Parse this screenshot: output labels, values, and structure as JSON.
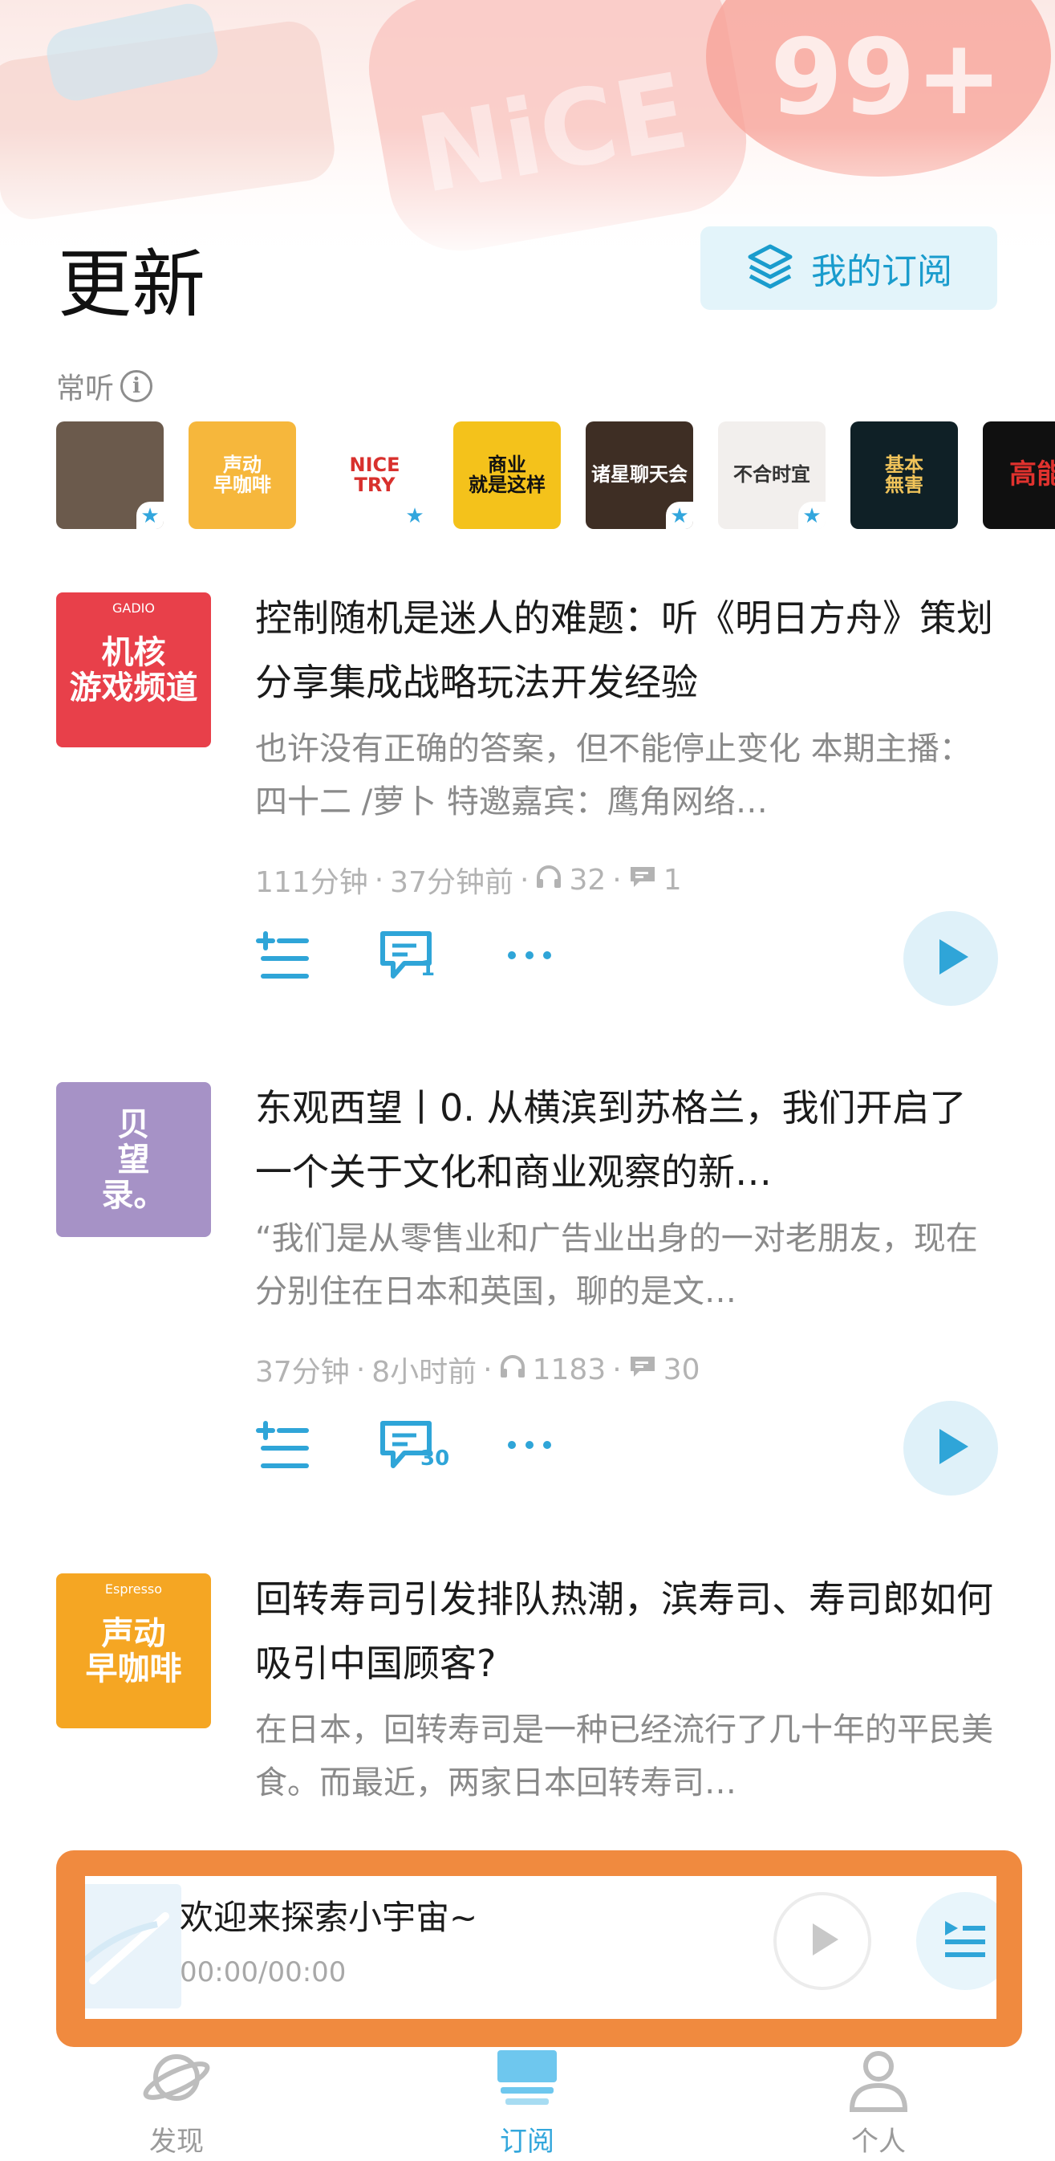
{
  "header": {
    "title": "更新",
    "my_subscriptions_label": "我的订阅"
  },
  "hero": {
    "badge_text": "99+",
    "art_text": "NiCE"
  },
  "frequent": {
    "label": "常听",
    "items": [
      {
        "name": "avatar-person",
        "caption": "",
        "bg": "#6b5a4c",
        "fg": "#ffffff",
        "starred": true
      },
      {
        "name": "声动早咖啡",
        "caption": "声动\n早咖啡",
        "bg": "#f6b73c",
        "fg": "#ffffff",
        "starred": false
      },
      {
        "name": "Nice Try",
        "caption": "NICE\nTRY",
        "bg": "#ffffff",
        "fg": "#d8302d",
        "starred": true
      },
      {
        "name": "商业就是这样",
        "caption": "商业\n就是这样",
        "bg": "#f4c21b",
        "fg": "#111111",
        "starred": false
      },
      {
        "name": "诸星聊天会",
        "caption": "诸星聊天会",
        "bg": "#3e2e24",
        "fg": "#ffffff",
        "starred": true
      },
      {
        "name": "不合时宜",
        "caption": "不合时宜",
        "bg": "#f2efed",
        "fg": "#333333",
        "starred": true
      },
      {
        "name": "基本无害",
        "caption": "基本\n無害",
        "bg": "#0f2026",
        "fg": "#f0c35a",
        "starred": false
      },
      {
        "name": "高能",
        "caption": "高能",
        "bg": "#101010",
        "fg": "#e0322e",
        "starred": false
      }
    ]
  },
  "episodes": [
    {
      "cover_caption": "机核\n游戏频道",
      "cover_small": "GADIO",
      "cover_bg": "#e8404a",
      "title": "控制随机是迷人的难题：听《明日方舟》策划分享集成战略玩法开发经验",
      "desc": "也许没有正确的答案，但不能停止变化 本期主播：四十二 /萝卜 特邀嘉宾：鹰角网络…",
      "duration": "111分钟",
      "ago": "37分钟前",
      "plays": "32",
      "comments": "1",
      "comment_badge": "1"
    },
    {
      "cover_caption": "贝\n望\n录。",
      "cover_small": "",
      "cover_bg": "#a692c6",
      "title": "东观西望丨0. 从横滨到苏格兰，我们开启了一个关于文化和商业观察的新…",
      "desc": "“我们是从零售业和广告业出身的一对老朋友，现在分别住在日本和英国，聊的是文…",
      "duration": "37分钟",
      "ago": "8小时前",
      "plays": "1183",
      "comments": "30",
      "comment_badge": "30"
    },
    {
      "cover_caption": "声动\n早咖啡",
      "cover_small": "Espresso",
      "cover_bg": "#f5a623",
      "title": "回转寿司引发排队热潮，滨寿司、寿司郎如何吸引中国顾客?",
      "desc": "在日本，回转寿司是一种已经流行了几十年的平民美食。而最近，两家日本回转寿司…",
      "duration": "",
      "ago": "",
      "plays": "",
      "comments": "",
      "comment_badge": ""
    }
  ],
  "player": {
    "title": "欢迎来探索小宇宙~",
    "time": "00:00/00:00"
  },
  "tabs": [
    {
      "label": "发现",
      "icon": "planet-icon",
      "active": false
    },
    {
      "label": "订阅",
      "icon": "subscription-stack-icon",
      "active": true
    },
    {
      "label": "个人",
      "icon": "person-icon",
      "active": false
    }
  ],
  "colors": {
    "accent": "#34a7dc",
    "highlight_border": "#f08a3f",
    "muted_text": "#8a8a8a"
  }
}
